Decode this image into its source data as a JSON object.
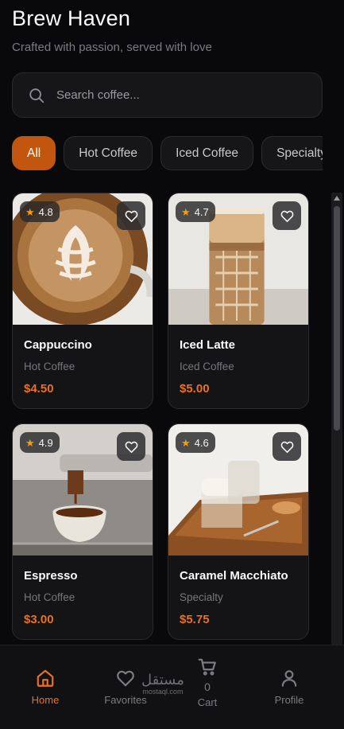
{
  "app": {
    "title": "Brew Haven",
    "subtitle": "Crafted with passion, served with love"
  },
  "search": {
    "placeholder": "Search coffee...",
    "icon": "search-icon"
  },
  "categories": [
    {
      "label": "All",
      "active": true
    },
    {
      "label": "Hot Coffee",
      "active": false
    },
    {
      "label": "Iced Coffee",
      "active": false
    },
    {
      "label": "Specialty",
      "active": false
    }
  ],
  "products": [
    {
      "name": "Cappuccino",
      "category": "Hot Coffee",
      "price": "$4.50",
      "rating": "4.8"
    },
    {
      "name": "Iced Latte",
      "category": "Iced Coffee",
      "price": "$5.00",
      "rating": "4.7"
    },
    {
      "name": "Espresso",
      "category": "Hot Coffee",
      "price": "$3.00",
      "rating": "4.9"
    },
    {
      "name": "Caramel Macchiato",
      "category": "Specialty",
      "price": "$5.75",
      "rating": "4.6"
    }
  ],
  "nav": {
    "home": "Home",
    "favorites": "Favorites",
    "cart": "Cart",
    "cart_count": "0",
    "profile": "Profile"
  },
  "watermark": {
    "text_ar": "مستقل",
    "text_en": "mostaql.com"
  },
  "colors": {
    "accent": "#c2560e",
    "price": "#e8711f",
    "star": "#f59e0b",
    "background": "#09090b",
    "card": "#141416"
  }
}
